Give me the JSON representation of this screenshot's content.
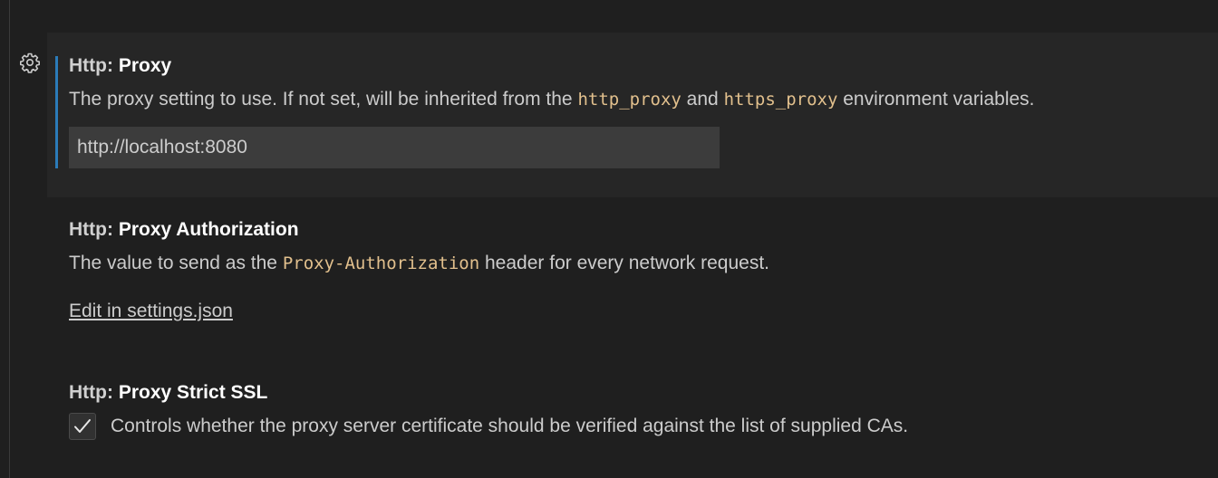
{
  "settings": [
    {
      "category": "Http: ",
      "name": "Proxy",
      "description": {
        "before": "The proxy setting to use. If not set, will be inherited from the ",
        "code1": "http_proxy",
        "middle": " and ",
        "code2": "https_proxy",
        "after": " environment variables."
      },
      "value": "http://localhost:8080"
    },
    {
      "category": "Http: ",
      "name": "Proxy Authorization",
      "description": {
        "before": "The value to send as the ",
        "code1": "Proxy-Authorization",
        "after": " header for every network request."
      },
      "link": "Edit in settings.json"
    },
    {
      "category": "Http: ",
      "name": "Proxy Strict SSL",
      "checked": true,
      "description": "Controls whether the proxy server certificate should be verified against the list of supplied CAs."
    }
  ],
  "icons": {
    "gear": "gear-icon",
    "check": "checkmark-icon"
  },
  "colors": {
    "background": "#1f1f1f",
    "focused_background": "#262626",
    "focus_accent": "#2b7bb9",
    "code": "#e2c08d",
    "input_background": "#3c3c3c"
  }
}
